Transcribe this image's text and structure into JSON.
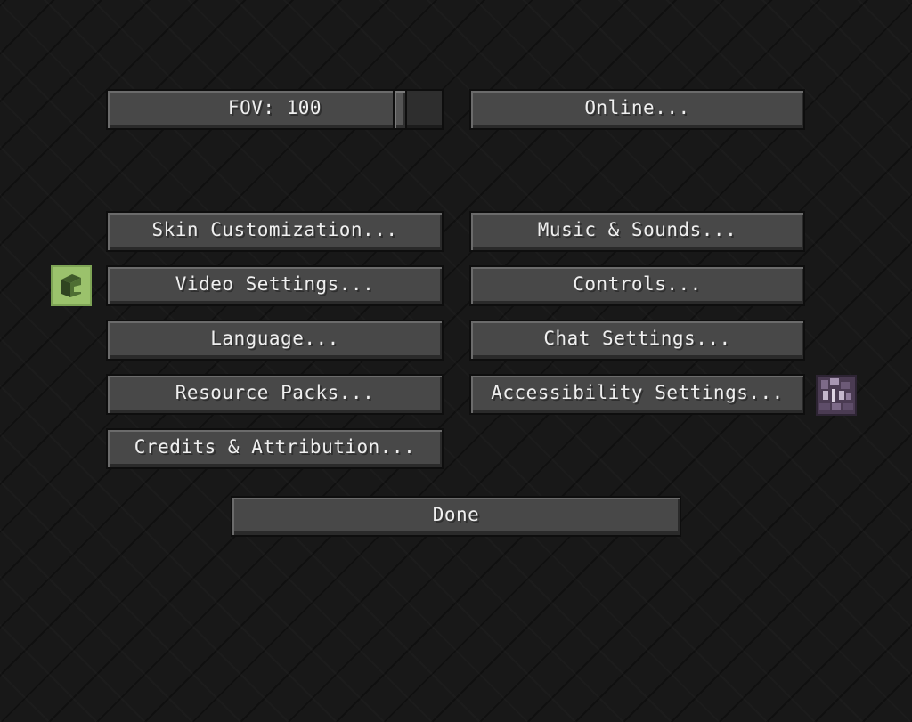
{
  "fov": {
    "label": "FOV: 100",
    "value": 100,
    "min": 30,
    "max": 110
  },
  "buttons": {
    "online": "Online...",
    "skin_customization": "Skin Customization...",
    "music_sounds": "Music & Sounds...",
    "video_settings": "Video Settings...",
    "controls": "Controls...",
    "language": "Language...",
    "chat_settings": "Chat Settings...",
    "resource_packs": "Resource Packs...",
    "accessibility_settings": "Accessibility Settings...",
    "credits_attribution": "Credits & Attribution...",
    "done": "Done"
  },
  "icons": {
    "video_settings_side": "green-cube-icon",
    "accessibility_side": "accessibility-skin-icon"
  },
  "colors": {
    "background": "#181818",
    "button": "#484848",
    "text": "#efefef",
    "green_icon": "#9bc26c",
    "purple_icon": "#4a3b52"
  }
}
